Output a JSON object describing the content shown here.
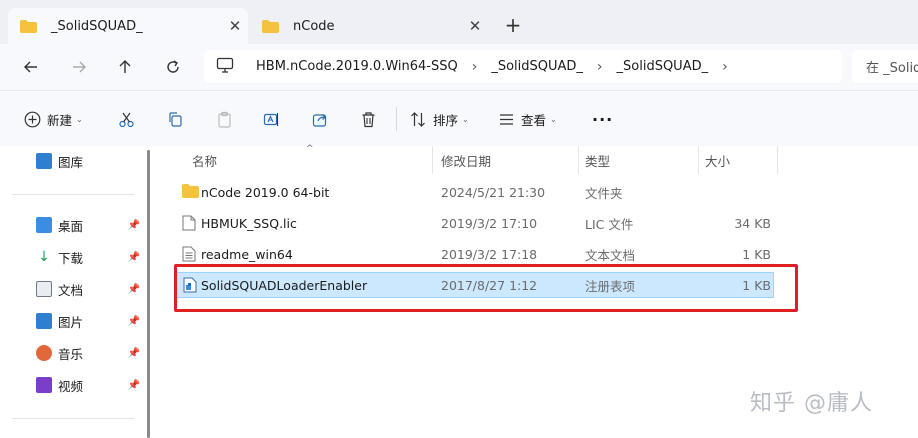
{
  "tabs": [
    {
      "label": "_SolidSQUAD_",
      "active": true
    },
    {
      "label": "nCode",
      "active": false
    }
  ],
  "new_tab_label": "+",
  "address": {
    "segments": [
      "HBM.nCode.2019.0.Win64-SSQ",
      "_SolidSQUAD_",
      "_SolidSQUAD_"
    ],
    "search_placeholder": "在 _Solid"
  },
  "toolbar": {
    "new_label": "新建",
    "sort_label": "排序",
    "view_label": "查看",
    "more_label": "···"
  },
  "sidebar": {
    "top_item": "图库",
    "items": [
      {
        "label": "桌面",
        "icon": "desktop-icon",
        "color": "#3a8de0"
      },
      {
        "label": "下载",
        "icon": "download-icon",
        "color": "#1f9d55"
      },
      {
        "label": "文档",
        "icon": "document-icon",
        "color": "#6b7b8c"
      },
      {
        "label": "图片",
        "icon": "pictures-icon",
        "color": "#2f7fd0"
      },
      {
        "label": "音乐",
        "icon": "music-icon",
        "color": "#e0683a"
      },
      {
        "label": "视频",
        "icon": "video-icon",
        "color": "#7a3fc8"
      }
    ]
  },
  "columns": {
    "name": "名称",
    "modified": "修改日期",
    "type": "类型",
    "size": "大小"
  },
  "files": [
    {
      "name": "nCode 2019.0 64-bit",
      "modified": "2024/5/21 21:30",
      "type": "文件夹",
      "size": "",
      "icon": "folder-icon"
    },
    {
      "name": "HBMUK_SSQ.lic",
      "modified": "2019/3/2 17:10",
      "type": "LIC 文件",
      "size": "34 KB",
      "icon": "file-icon"
    },
    {
      "name": "readme_win64",
      "modified": "2019/3/2 17:18",
      "type": "文本文档",
      "size": "1 KB",
      "icon": "text-file-icon"
    },
    {
      "name": "SolidSQUADLoaderEnabler",
      "modified": "2017/8/27 1:12",
      "type": "注册表项",
      "size": "1 KB",
      "icon": "registry-file-icon",
      "selected": true
    }
  ],
  "watermark": "知乎 @庸人",
  "colors": {
    "selection": "#cce8ff",
    "highlight_box": "#e02020",
    "folder": "#f4c23d"
  }
}
